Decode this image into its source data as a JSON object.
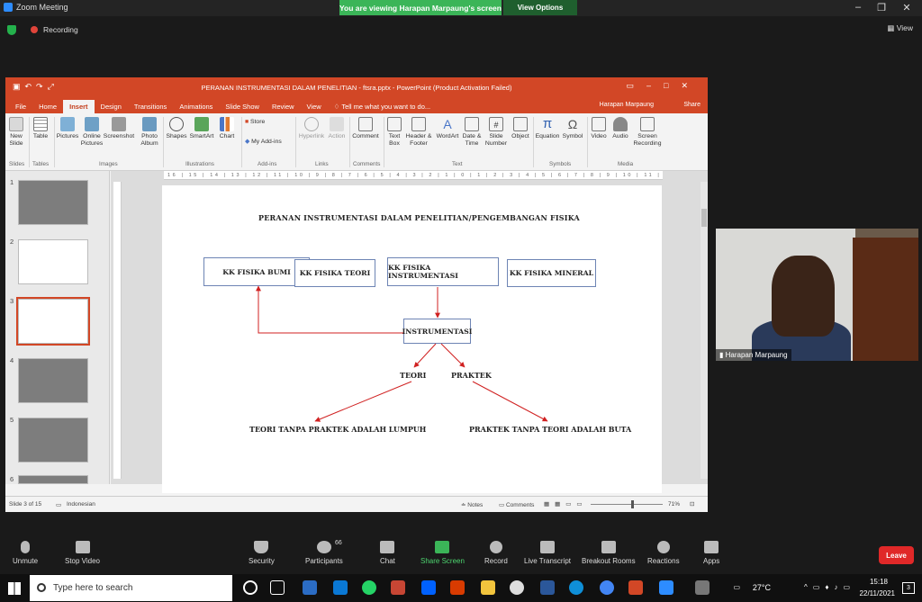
{
  "zoom": {
    "app_title": "Zoom Meeting",
    "share_banner": "You are viewing Harapan Marpaung's screen",
    "view_options": "View Options",
    "recording": "Recording",
    "view": "View"
  },
  "ppt": {
    "title": "PERANAN INSTRUMENTASI DALAM PENELITIAN - ftsra.pptx - PowerPoint (Product Activation Failed)",
    "tabs": [
      "File",
      "Home",
      "Insert",
      "Design",
      "Transitions",
      "Animations",
      "Slide Show",
      "Review",
      "View"
    ],
    "tell_me": "Tell me what you want to do...",
    "user": "Harapan Marpaung",
    "share": "Share",
    "ribbon": {
      "new_slide": "New Slide",
      "table": "Table",
      "pictures": "Pictures",
      "online_pictures": "Online Pictures",
      "screenshot": "Screenshot",
      "photo_album": "Photo Album",
      "shapes": "Shapes",
      "smartart": "SmartArt",
      "chart": "Chart",
      "store": "Store",
      "my_addins": "My Add-ins",
      "hyperlink": "Hyperlink",
      "action": "Action",
      "comment": "Comment",
      "text_box": "Text Box",
      "header_footer": "Header & Footer",
      "wordart": "WordArt",
      "date_time": "Date & Time",
      "slide_number": "Slide Number",
      "object": "Object",
      "equation": "Equation",
      "symbol": "Symbol",
      "video": "Video",
      "audio": "Audio",
      "screen_recording": "Screen Recording",
      "groups": [
        "Slides",
        "Tables",
        "Images",
        "Illustrations",
        "Add-ins",
        "Links",
        "Comments",
        "Text",
        "Symbols",
        "Media"
      ]
    },
    "ruler_text": "16 | 15 | 14 | 13 | 12 | 11 | 10 | 9 | 8 | 7 | 6 | 5 | 4 | 3 | 2 | 1 | 0 | 1 | 2 | 3 | 4 | 5 | 6 | 7 | 8 | 9 | 10 | 11 | 12 | 13 | 14 | 15 | 16",
    "thumb_numbers": [
      "1",
      "2",
      "3",
      "4",
      "5",
      "6"
    ],
    "slide": {
      "title": "PERANAN INSTRUMENTASI DALAM PENELITIAN/PENGEMBANGAN FISIKA",
      "kk_bumi": "KK FISIKA BUMI",
      "kk_teori": "KK FISIKA TEORI",
      "kk_instrumentasi": "KK FISIKA INSTRUMENTASI",
      "kk_mineral": "KK FISIKA MINERAL",
      "instrumentasi": "INSTRUMENTASI",
      "teori": "TEORI",
      "praktek": "PRAKTEK",
      "teori_tanpa": "TEORI TANPA PRAKTEK ADALAH LUMPUH",
      "praktek_tanpa": "PRAKTEK TANPA TEORI ADALAH BUTA"
    },
    "status": {
      "slide_of": "Slide 3 of 15",
      "language": "Indonesian",
      "notes": "Notes",
      "comments": "Comments",
      "zoom": "71%"
    },
    "accent": "#d24726"
  },
  "video": {
    "name": "Harapan Marpaung"
  },
  "toolbar": {
    "unmute": "Unmute",
    "stop_video": "Stop Video",
    "security": "Security",
    "participants": "Participants",
    "participants_count": "66",
    "chat": "Chat",
    "share_screen": "Share Screen",
    "record": "Record",
    "live_transcript": "Live Transcript",
    "breakout_rooms": "Breakout Rooms",
    "reactions": "Reactions",
    "apps": "Apps",
    "leave": "Leave"
  },
  "taskbar": {
    "search_placeholder": "Type here to search",
    "temperature": "27°C",
    "time": "15:18",
    "date": "22/11/2021",
    "notifications": "3"
  }
}
